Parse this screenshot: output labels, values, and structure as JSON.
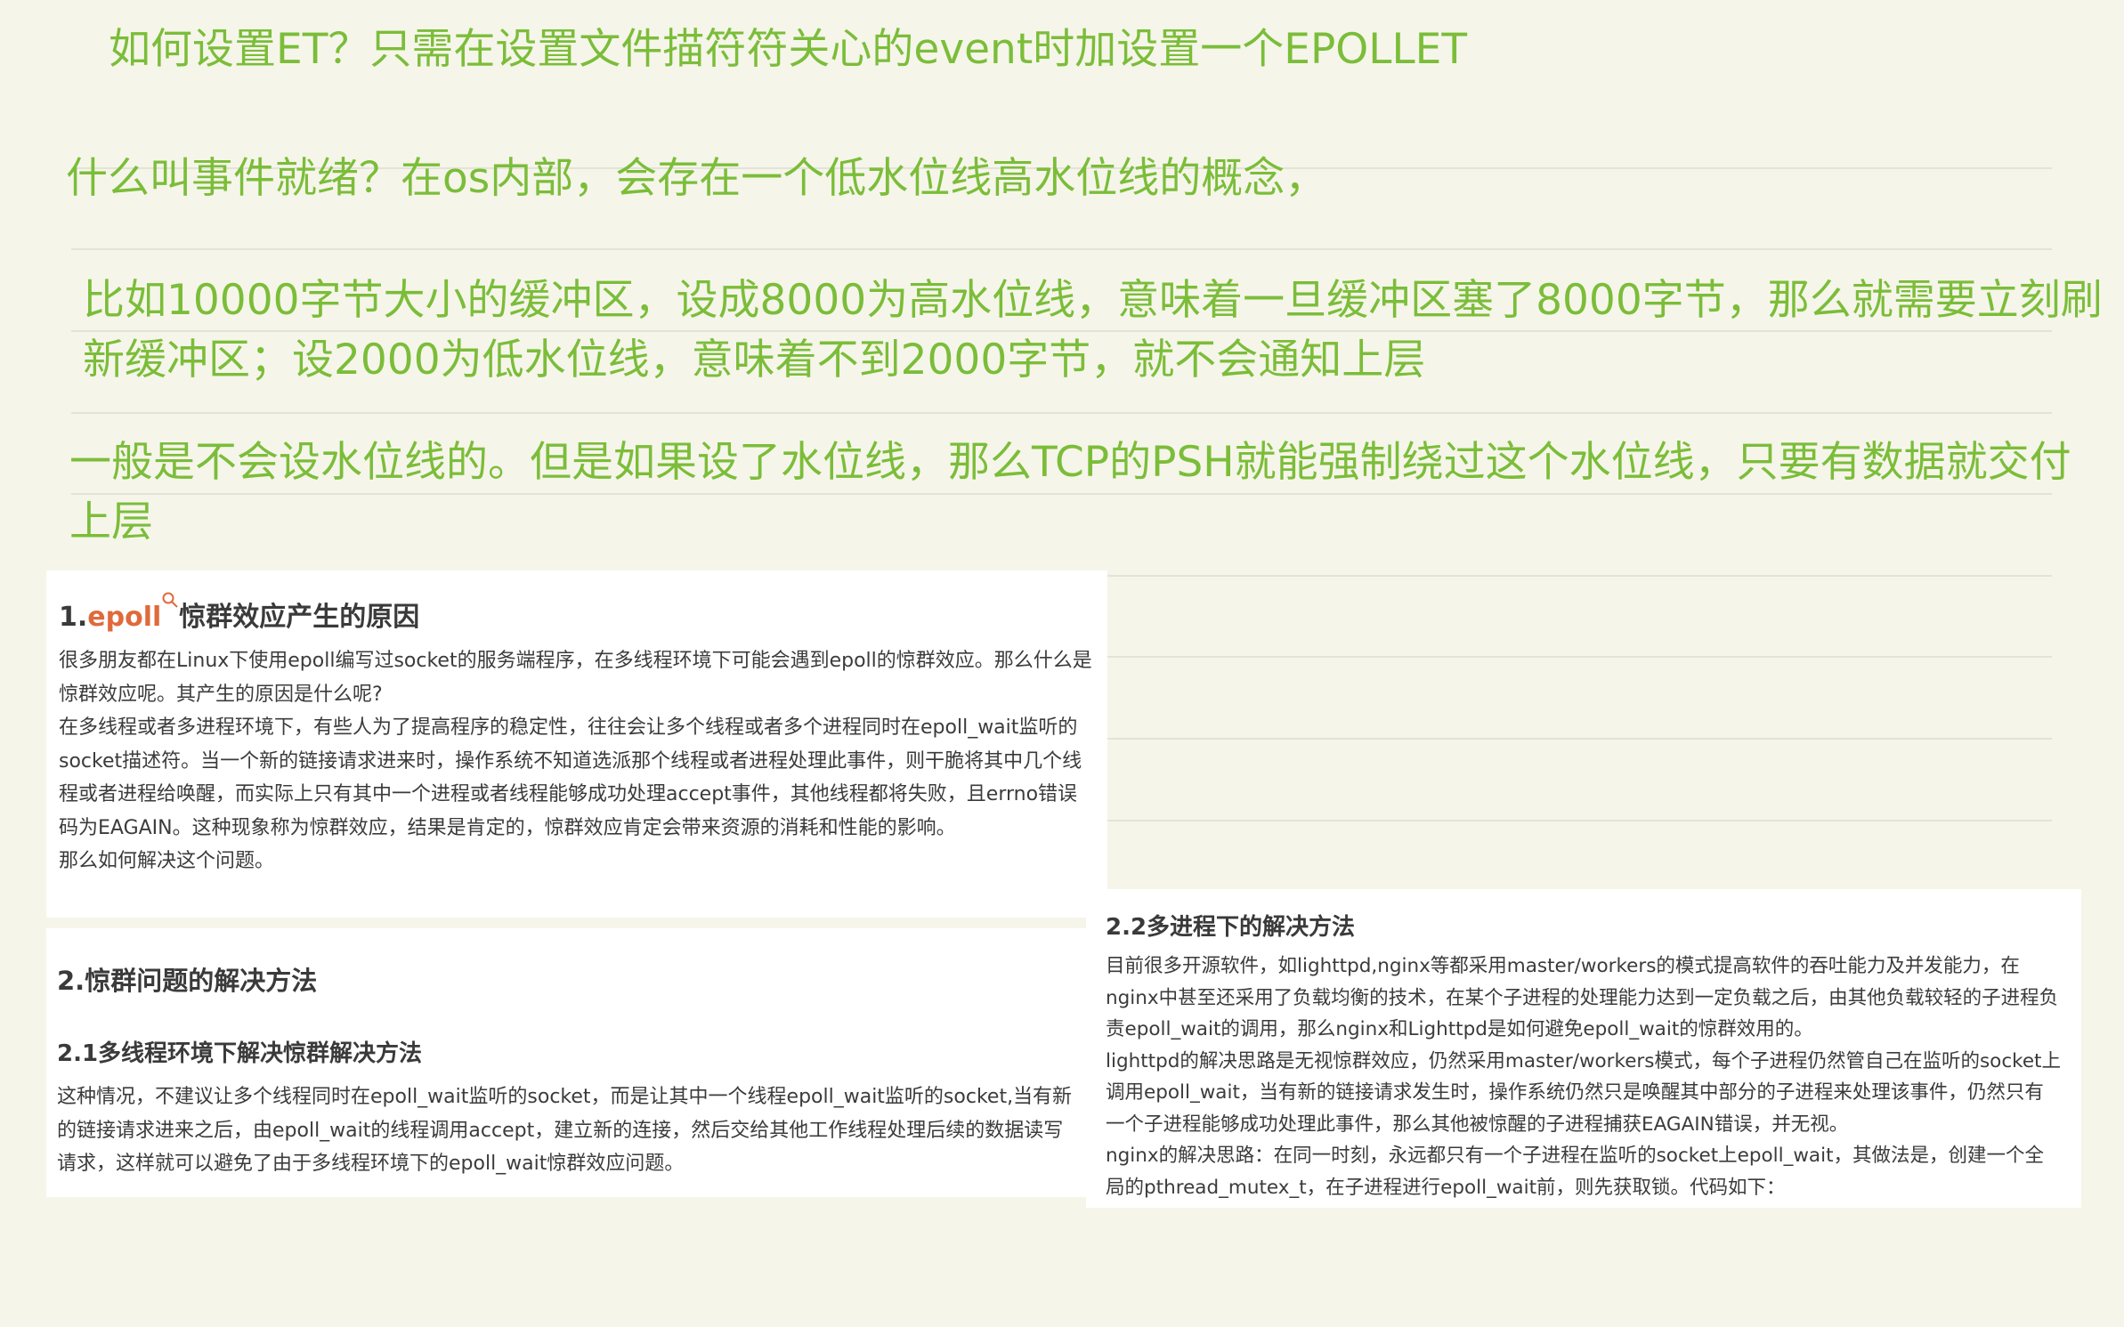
{
  "notes": {
    "line1": "如何设置ET？只需在设置文件描符符关心的event时加设置一个EPOLLET",
    "line2": "什么叫事件就绪？在os内部，会存在一个低水位线高水位线的概念，",
    "line3": "比如10000字节大小的缓冲区，设成8000为高水位线，意味着一旦缓冲区塞了8000字节，那么就需要立刻刷新缓冲区；设2000为低水位线，意味着不到2000字节，就不会通知上层",
    "line4": "一般是不会设水位线的。但是如果设了水位线，那么TCP的PSH就能强制绕过这个水位线，只要有数据就交付上层"
  },
  "section1": {
    "num": "1.",
    "keyword": "epoll",
    "title_rest": "惊群效应产生的原因",
    "p1": "很多朋友都在Linux下使用epoll编写过socket的服务端程序，在多线程环境下可能会遇到epoll的惊群效应。那么什么是惊群效应呢。其产生的原因是什么呢?",
    "p2": "在多线程或者多进程环境下，有些人为了提高程序的稳定性，往往会让多个线程或者多个进程同时在epoll_wait监听的socket描述符。当一个新的链接请求进来时，操作系统不知道选派那个线程或者进程处理此事件，则干脆将其中几个线程或者进程给唤醒，而实际上只有其中一个进程或者线程能够成功处理accept事件，其他线程都将失败，且errno错误码为EAGAIN。这种现象称为惊群效应，结果是肯定的，惊群效应肯定会带来资源的消耗和性能的影响。",
    "p3": "那么如何解决这个问题。"
  },
  "section2": {
    "title": "2.惊群问题的解决方法",
    "sub_title": "2.1多线程环境下解决惊群解决方法",
    "p1": "这种情况，不建议让多个线程同时在epoll_wait监听的socket，而是让其中一个线程epoll_wait监听的socket,当有新的链接请求进来之后，由epoll_wait的线程调用accept，建立新的连接，然后交给其他工作线程处理后续的数据读写请求，这样就可以避免了由于多线程环境下的epoll_wait惊群效应问题。"
  },
  "section22": {
    "title": "2.2多进程下的解决方法",
    "p1": "目前很多开源软件，如lighttpd,nginx等都采用master/workers的模式提高软件的吞吐能力及并发能力，在nginx中甚至还采用了负载均衡的技术，在某个子进程的处理能力达到一定负载之后，由其他负载较轻的子进程负责epoll_wait的调用，那么nginx和Lighttpd是如何避免epoll_wait的惊群效用的。",
    "p2": "lighttpd的解决思路是无视惊群效应，仍然采用master/workers模式，每个子进程仍然管自己在监听的socket上调用epoll_wait，当有新的链接请求发生时，操作系统仍然只是唤醒其中部分的子进程来处理该事件，仍然只有一个子进程能够成功处理此事件，那么其他被惊醒的子进程捕获EAGAIN错误，并无视。",
    "p3": "nginx的解决思路：在同一时刻，永远都只有一个子进程在监听的socket上epoll_wait，其做法是，创建一个全局的pthread_mutex_t，在子进程进行epoll_wait前，则先获取锁。代码如下："
  },
  "colors": {
    "note": "#7bbd39",
    "accent": "#e06a3c",
    "background": "#f6f5ea"
  },
  "icons": {
    "keyword_marker": "search-icon"
  }
}
